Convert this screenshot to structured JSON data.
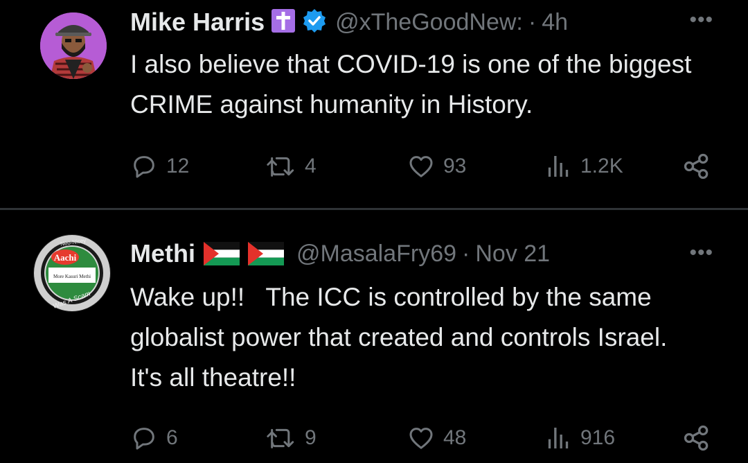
{
  "tweets": [
    {
      "name": "Mike Harris",
      "handle": "@xTheGoodNew:",
      "time": "4h",
      "text": "I also believe that COVID-19 is one of the biggest CRIME against humanity in History.",
      "replies": "12",
      "reposts": "4",
      "likes": "93",
      "views": "1.2K"
    },
    {
      "name": "Methi",
      "handle": "@MasalaFry69",
      "time": "Nov 21",
      "text": "Wake up!!   The ICC is controlled by the same globalist power that created and controls Israel. It's all theatre!!",
      "replies": "6",
      "reposts": "9",
      "likes": "48",
      "views": "916",
      "avatar_text": {
        "top": "Neo-Nicey",
        "brand": "Aachi",
        "label": "More Kasuri Methi",
        "bottom": "#It Was A Scam"
      }
    }
  ],
  "separator": "·",
  "more_label": "•••",
  "colors": {
    "background": "#000000",
    "text": "#e7e9ea",
    "muted": "#71767b",
    "verified": "#1d9bf0",
    "cross_badge": "#a56ee6",
    "divider": "#2f3336"
  }
}
